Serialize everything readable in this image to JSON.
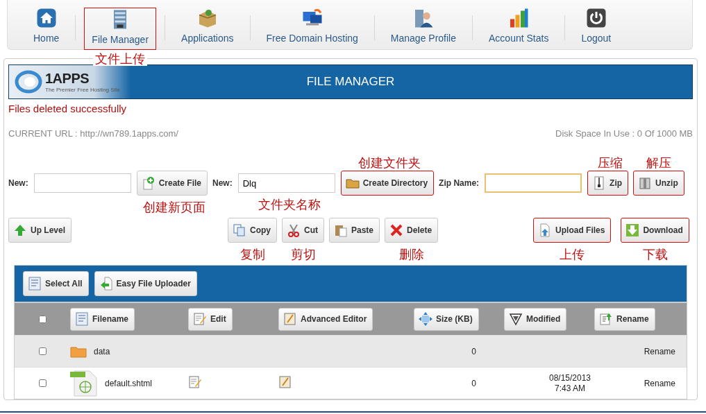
{
  "nav": [
    {
      "label": "Home",
      "highlighted": false
    },
    {
      "label": "File Manager",
      "highlighted": true,
      "note": "文件上传"
    },
    {
      "label": "Applications",
      "highlighted": false
    },
    {
      "label": "Free Domain Hosting",
      "highlighted": false
    },
    {
      "label": "Manage Profile",
      "highlighted": false
    },
    {
      "label": "Account Stats",
      "highlighted": false
    },
    {
      "label": "Logout",
      "highlighted": false
    }
  ],
  "header": {
    "logo": "1APPS",
    "tagline": "The Premier Free Hosting Site",
    "title": "FILE MANAGER"
  },
  "message": "Files deleted successfully",
  "current_url": "CURRENT URL : http://wn789.1apps.com/",
  "disk_space": "Disk Space In Use : 0 Of 1000 MB",
  "form_row": [
    {
      "kind": "label",
      "text": "New:"
    },
    {
      "kind": "field",
      "focused": false
    },
    {
      "kind": "button",
      "label": "Create File",
      "highlighted": false,
      "note": "创建新页面"
    },
    {
      "kind": "label",
      "text": "New:"
    },
    {
      "kind": "field",
      "focused": false,
      "value": "Dlq",
      "note": "文件夹名称"
    },
    {
      "kind": "button",
      "label": "Create Directory",
      "highlighted": true,
      "note": "创建文件夹"
    },
    {
      "kind": "label",
      "text": "Zip Name:"
    },
    {
      "kind": "field",
      "focused": true
    },
    {
      "kind": "button",
      "label": "Zip",
      "highlighted": true,
      "note": "压缩"
    },
    {
      "kind": "button",
      "label": "Unzip",
      "highlighted": true,
      "note": "解压"
    }
  ],
  "action_groups": [
    {
      "buttons": [
        {
          "label": "Up Level",
          "highlighted": false
        }
      ]
    },
    {
      "buttons": [
        {
          "label": "Copy",
          "highlighted": false,
          "note": "复制"
        },
        {
          "label": "Cut",
          "highlighted": false,
          "note": "剪切"
        },
        {
          "label": "Paste",
          "highlighted": false
        },
        {
          "label": "Delete",
          "highlighted": false,
          "note": "删除"
        }
      ]
    },
    {
      "buttons": [
        {
          "label": "Upload Files",
          "highlighted": true,
          "note": "上传"
        },
        {
          "label": "Download",
          "highlighted": true,
          "note": "下载"
        }
      ]
    }
  ],
  "table_toolbar": [
    "Select All",
    "Easy File Uploader"
  ],
  "table": {
    "select_all_checked": false,
    "columns": [
      "Filename",
      "Edit",
      "Advanced Editor",
      "Size (KB)",
      "Modified",
      "Rename"
    ],
    "rows": [
      {
        "kind": "folder",
        "checked": false,
        "name": "data",
        "size": "0",
        "rename": "Rename"
      },
      {
        "kind": "file",
        "checked": false,
        "name": "default.shtml",
        "size": "0",
        "modified_date": "08/15/2013",
        "modified_time": "7:43 AM",
        "rename": "Rename"
      }
    ]
  }
}
